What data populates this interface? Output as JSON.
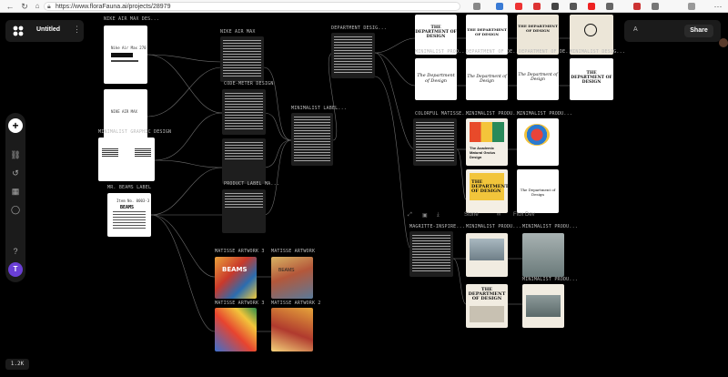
{
  "browser": {
    "url": "https://www.floraFauna.ai/projects/28979",
    "back_icon": "back-arrow-icon",
    "refresh_icon": "refresh-icon",
    "lock_icon": "lock-icon"
  },
  "project": {
    "title": "Untitled",
    "menu": "⋮"
  },
  "share": {
    "user_initial": "A",
    "button_label": "Share"
  },
  "toolbar": {
    "add_label": "+",
    "avatar_initial": "T",
    "tools": [
      "workflow-icon",
      "history-icon",
      "assets-icon",
      "comments-icon",
      "help-icon"
    ]
  },
  "zoom": {
    "label": "1.2K"
  },
  "floating_toolbar": {
    "items": [
      "Stone",
      "Flux Dev"
    ]
  },
  "nodes": {
    "nike_air_max_des": "NIKE AIR MAX DES...",
    "nike_air_max": "NIKE AIR MAX",
    "code_meter_design": "CODE-METER DESIGN",
    "minimalist_graphic_design": "MINIMALIST GRAPHIC DESIGN",
    "mr_beams_label": "MR. BEAMS LABEL",
    "product_label_ma": "PRODUCT LABEL MA...",
    "minimalist_label": "MINIMALIST LABEL...",
    "department_desig": "DEPARTMENT DESIG...",
    "minimalist_prod_1": "MINIMALIST PROD...",
    "department_of_de": "DEPARTMENT OF DE...",
    "department_of_de_2": "DEPARTMENT OF DE...",
    "minimalist_desig": "MINIMALIST DESIG...",
    "colorful_matisse": "COLORFUL MATISSE...",
    "minimalist_produ_1": "MINIMALIST PRODU...",
    "minimalist_produ_2": "MINIMALIST PRODU...",
    "matisse_artwork_3a": "MATISSE ARTWORK 3",
    "matisse_artwork_a": "MATISSE ARTWORK",
    "matisse_artwork_3b": "MATISSE ARTWORK 3",
    "matisse_artwork_2": "MATISSE ARTWORK 2",
    "magritte_inspire": "MAGRITTE-INSPIRE...",
    "minimalist_produ_3": "MINIMALIST PRODU...",
    "minimalist_produ_4": "MINIMALIST PRODU...",
    "minimalist_produ_5": "MINIMALIST PRODU..."
  },
  "card_text": {
    "dept_title_1": "THE DEPARTMENT OF DESIGN",
    "dept_title_2": "THE DEPARTMENT OF DESIGN",
    "dept_title_3": "THE DEPARTMENT OF DESIGN",
    "dept_title_4": "THE DEPARTMENT OF DESIGN",
    "dept_script_1": "The Department of Design",
    "dept_script_2": "The Department of Design",
    "dept_script_3": "The Department of Design",
    "academic_title": "The Academic Matural Grolus Design",
    "dept_colorful": "THE DEPARTMENT OF DESIGN",
    "dept_poster": "THE DEPARTMENT OF DESIGN",
    "dept_script_4": "The Department of Design",
    "beams_1": "BEAMS",
    "beams_2": "BEAMS",
    "beams_label_name": "Item No. 0003-3",
    "beams_brand": "BEAMS",
    "nike_label_1": "Nike Air Max 270",
    "nike_label_2": "NIKE AIR MAX"
  },
  "colors": {
    "canvas": "#000000",
    "panel": "#1b1b1b",
    "wire": "#8a8a8a",
    "avatar": "#6a3fd6",
    "cream": "#f1ece1"
  }
}
